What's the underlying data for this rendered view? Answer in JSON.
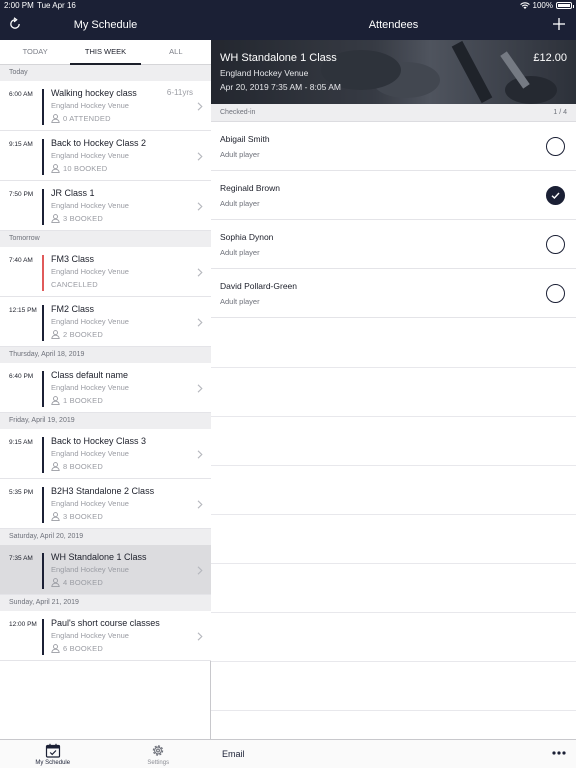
{
  "status_bar": {
    "time": "2:00 PM",
    "date": "Tue Apr 16",
    "battery": "100%"
  },
  "left": {
    "title": "My Schedule",
    "tabs": [
      {
        "label": "TODAY",
        "active": false
      },
      {
        "label": "THIS WEEK",
        "active": true
      },
      {
        "label": "ALL",
        "active": false
      }
    ],
    "sections": [
      {
        "header": "Today",
        "items": [
          {
            "time": "6:00 AM",
            "name": "Walking hockey class",
            "venue": "England Hockey Venue",
            "status": "0 ATTENDED",
            "age": "6-11yrs"
          },
          {
            "time": "9:15 AM",
            "name": "Back to Hockey Class 2",
            "venue": "England Hockey Venue",
            "status": "10 BOOKED"
          },
          {
            "time": "7:50 PM",
            "name": "JR Class 1",
            "venue": "England Hockey Venue",
            "status": "3 BOOKED"
          }
        ]
      },
      {
        "header": "Tomorrow",
        "items": [
          {
            "time": "7:40 AM",
            "name": "FM3 Class",
            "venue": "England Hockey Venue",
            "status": "CANCELLED",
            "cancelled": true
          },
          {
            "time": "12:15 PM",
            "name": "FM2 Class",
            "venue": "England Hockey Venue",
            "status": "2 BOOKED"
          }
        ]
      },
      {
        "header": "Thursday, April 18, 2019",
        "items": [
          {
            "time": "6:40 PM",
            "name": "Class default name",
            "venue": "England Hockey Venue",
            "status": "1 BOOKED"
          }
        ]
      },
      {
        "header": "Friday, April 19, 2019",
        "items": [
          {
            "time": "9:15 AM",
            "name": "Back to Hockey Class 3",
            "venue": "England Hockey Venue",
            "status": "8 BOOKED"
          },
          {
            "time": "5:35 PM",
            "name": "B2H3 Standalone 2 Class",
            "venue": "England Hockey Venue",
            "status": "3 BOOKED"
          }
        ]
      },
      {
        "header": "Saturday, April 20, 2019",
        "items": [
          {
            "time": "7:35 AM",
            "name": "WH Standalone 1 Class",
            "venue": "England Hockey Venue",
            "status": "4 BOOKED",
            "selected": true
          }
        ]
      },
      {
        "header": "Sunday, April 21, 2019",
        "items": [
          {
            "time": "12:00 PM",
            "name": "Paul's short course classes",
            "venue": "England Hockey Venue",
            "status": "6 BOOKED"
          }
        ]
      }
    ],
    "tabbar": [
      {
        "label": "My Schedule",
        "icon": "calendar-check-icon",
        "active": true
      },
      {
        "label": "Settings",
        "icon": "gear-icon",
        "active": false
      }
    ]
  },
  "right": {
    "title": "Attendees",
    "class_title": "WH Standalone 1 Class",
    "price": "£12.00",
    "venue": "England Hockey Venue",
    "datetime": "Apr 20, 2019  7:35 AM - 8:05 AM",
    "checked_in_label": "Checked-in",
    "checked_in_count": "1 / 4",
    "attendees": [
      {
        "name": "Abigail Smith",
        "type": "Adult player",
        "checked": false
      },
      {
        "name": "Reginald Brown",
        "type": "Adult player",
        "checked": true
      },
      {
        "name": "Sophia Dynon",
        "type": "Adult player",
        "checked": false
      },
      {
        "name": "David Pollard-Green",
        "type": "Adult player",
        "checked": false
      }
    ],
    "email_label": "Email",
    "colors": {
      "nav": "#1b2035",
      "cancelled": "#e05a5a"
    }
  }
}
